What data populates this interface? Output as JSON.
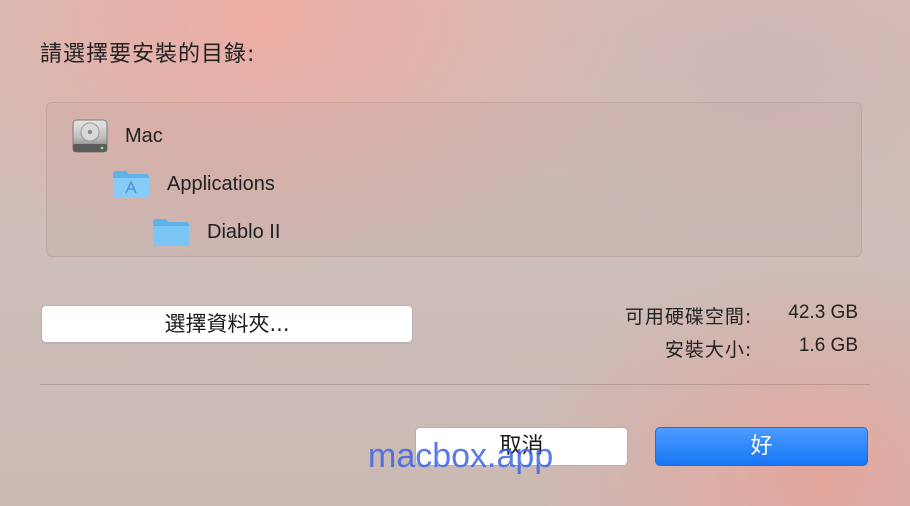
{
  "dialog": {
    "title": "請選擇要安裝的目錄:"
  },
  "location": {
    "items": [
      {
        "label": "Mac",
        "icon": "hard-drive-icon"
      },
      {
        "label": "Applications",
        "icon": "applications-folder-icon"
      },
      {
        "label": "Diablo II",
        "icon": "folder-icon"
      }
    ]
  },
  "buttons": {
    "choose_folder": "選擇資料夾...",
    "cancel": "取消",
    "ok": "好"
  },
  "disk_info": {
    "available_label": "可用硬碟空間:",
    "available_value": "42.3 GB",
    "install_size_label": "安裝大小:",
    "install_size_value": "1.6 GB"
  },
  "watermark": "macbox.app",
  "colors": {
    "primary_button": "#1677f5",
    "folder_blue": "#6cc0f2"
  }
}
